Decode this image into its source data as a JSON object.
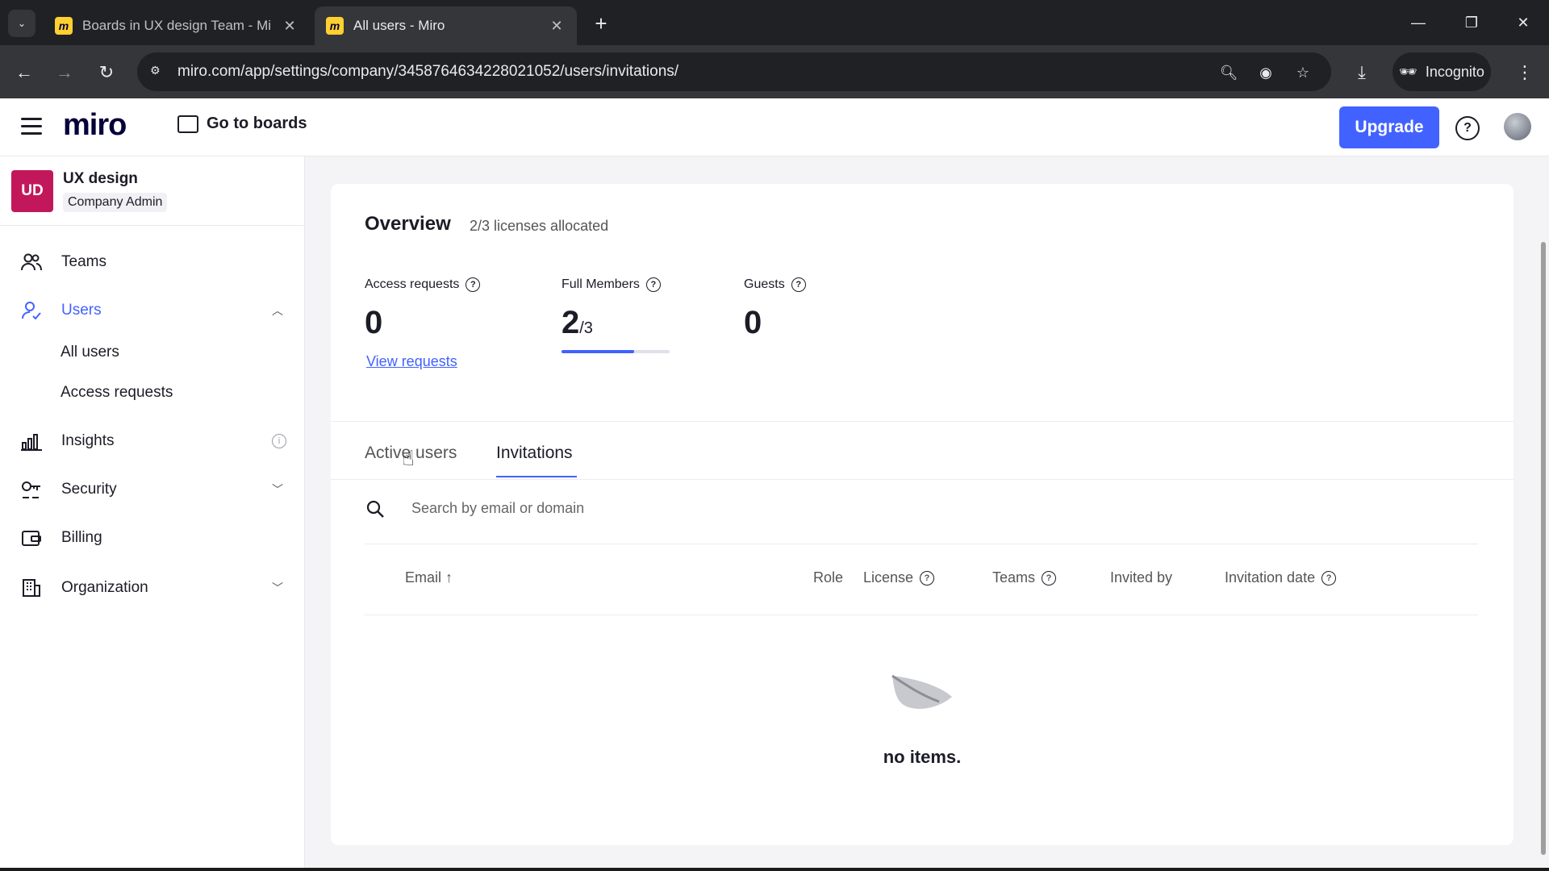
{
  "browser": {
    "tabs": [
      {
        "title": "Boards in UX design Team - Mi",
        "active": false
      },
      {
        "title": "All users - Miro",
        "active": true
      }
    ],
    "url": "miro.com/app/settings/company/3458764634228021052/users/invitations/",
    "incognito_label": "Incognito"
  },
  "header": {
    "logo": "miro",
    "go_to_boards": "Go to boards",
    "upgrade": "Upgrade",
    "help": "?"
  },
  "sidebar": {
    "org_badge": "UD",
    "org_name": "UX design",
    "org_role": "Company Admin",
    "items": [
      {
        "label": "Teams",
        "icon": "teams-icon"
      },
      {
        "label": "Users",
        "icon": "users-icon",
        "active": true,
        "expanded": true
      },
      {
        "label": "Insights",
        "icon": "insights-icon"
      },
      {
        "label": "Security",
        "icon": "security-icon"
      },
      {
        "label": "Billing",
        "icon": "billing-icon"
      },
      {
        "label": "Organization",
        "icon": "organization-icon"
      }
    ],
    "user_subitems": [
      "All users",
      "Access requests"
    ]
  },
  "overview": {
    "title": "Overview",
    "subtitle": "2/3 licenses allocated",
    "access_requests": {
      "label": "Access requests",
      "value": "0",
      "link": "View requests"
    },
    "full_members": {
      "label": "Full Members",
      "value": "2",
      "total": "/3",
      "progress": 0.67
    },
    "guests": {
      "label": "Guests",
      "value": "0"
    }
  },
  "tabs": [
    {
      "label": "Active users",
      "active": false
    },
    {
      "label": "Invitations",
      "active": true
    }
  ],
  "search": {
    "placeholder": "Search by email or domain",
    "value": ""
  },
  "table": {
    "columns": [
      "Email ↑",
      "Role",
      "License",
      "Teams",
      "Invited by",
      "Invitation date"
    ],
    "rows": [],
    "empty_text": "no items."
  },
  "colors": {
    "accent": "#4262ff",
    "org_badge": "#c2185b"
  }
}
